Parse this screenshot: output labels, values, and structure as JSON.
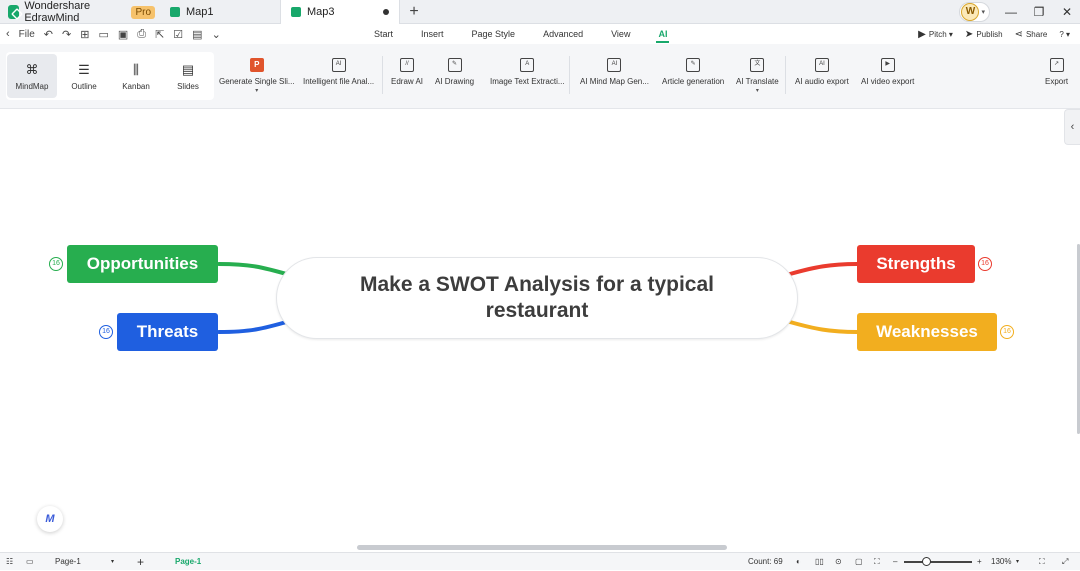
{
  "app": {
    "name": "Wondershare EdrawMind",
    "badge": "Pro"
  },
  "tabs": [
    {
      "label": "Map1"
    },
    {
      "label": "Map3"
    }
  ],
  "account": {
    "avatar_letter": "W"
  },
  "menubar": {
    "file_label": "File",
    "tabs": [
      "Start",
      "Insert",
      "Page Style",
      "Advanced",
      "View",
      "AI"
    ],
    "active_tab": "AI",
    "right": {
      "pitch": "Pitch",
      "publish": "Publish",
      "share": "Share"
    }
  },
  "ribbon": {
    "views": [
      "MindMap",
      "Outline",
      "Kanban",
      "Slides"
    ],
    "active_view": "MindMap",
    "tools": [
      "Generate Single Sli...",
      "Intelligent file Anal...",
      "Edraw AI",
      "AI Drawing",
      "Image Text Extracti...",
      "AI Mind Map Gen...",
      "Article generation",
      "AI Translate",
      "AI audio export",
      "AI video export",
      "Export"
    ]
  },
  "mindmap": {
    "central": "Make a SWOT Analysis for a typical restaurant",
    "topics": {
      "opportunities": {
        "label": "Opportunities",
        "count": "16",
        "color": "#27ae4f"
      },
      "threats": {
        "label": "Threats",
        "count": "16",
        "color": "#1f5fe0"
      },
      "strengths": {
        "label": "Strengths",
        "count": "16",
        "color": "#ea3b2e"
      },
      "weaknesses": {
        "label": "Weaknesses",
        "count": "16",
        "color": "#f2ae1f"
      }
    }
  },
  "statusbar": {
    "page_select": "Page-1",
    "page_tab": "Page-1",
    "count": "Count: 69",
    "zoom": "130%"
  }
}
